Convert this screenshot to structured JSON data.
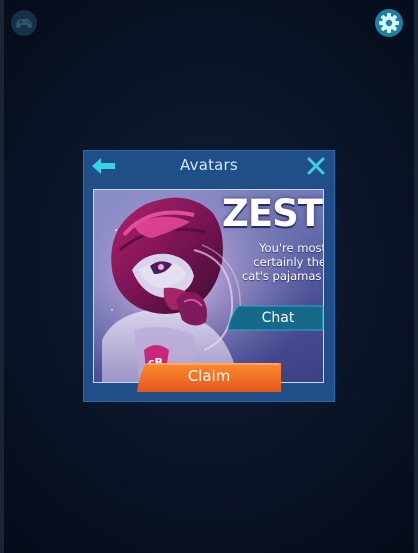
{
  "top_bar": {
    "left_icon": "gamepad-icon",
    "right_icon": "gear-icon"
  },
  "modal": {
    "title": "Avatars",
    "back_icon": "arrow-left-icon",
    "close_icon": "close-icon"
  },
  "avatar_card": {
    "name": "ZEST",
    "tagline": "You're most certainly the cat's pajamas!"
  },
  "buttons": {
    "chat_label": "Chat",
    "claim_label": "Claim"
  },
  "colors": {
    "modal_bg": "#1f4f86",
    "accent_cyan": "#38d1e8",
    "claim_orange": "#f26a22",
    "chat_teal": "#1a6f8f"
  }
}
